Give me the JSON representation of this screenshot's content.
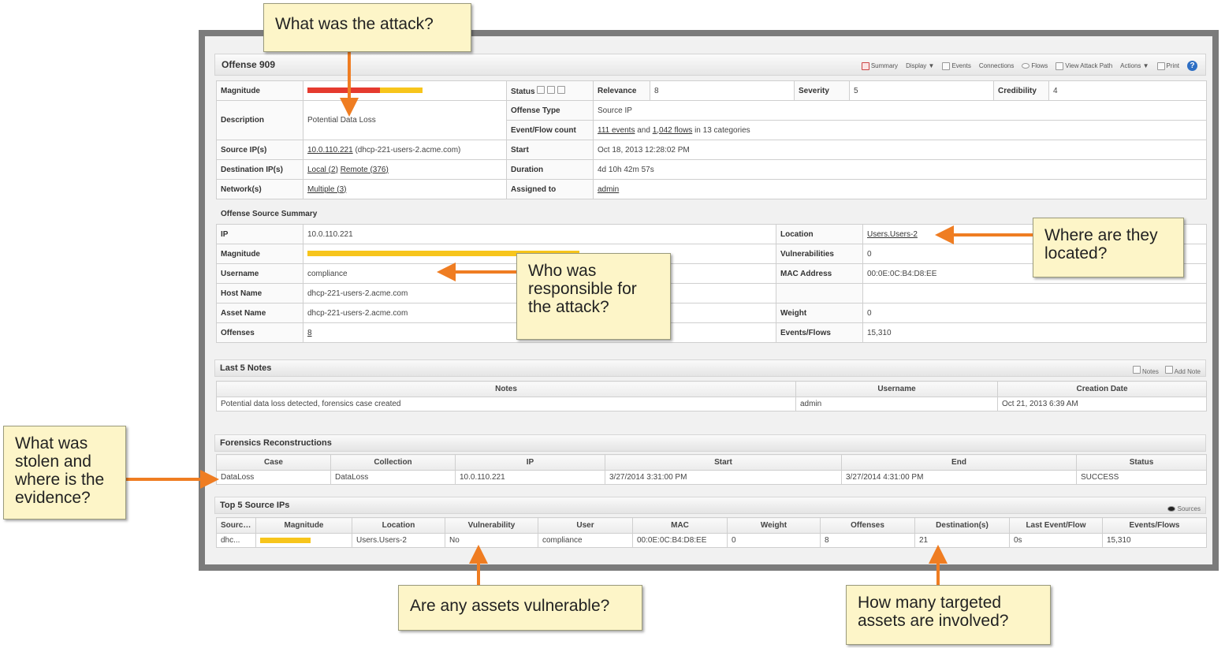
{
  "offense": {
    "title": "Offense 909",
    "toolbar": [
      "Summary",
      "Display ▼",
      "Events",
      "Connections",
      "Flows",
      "View Attack Path",
      "Actions ▼",
      "Print"
    ],
    "help": "?"
  },
  "main": {
    "magnitude_label": "Magnitude",
    "status_label": "Status",
    "relevance_label": "Relevance",
    "relevance": "8",
    "severity_label": "Severity",
    "severity": "5",
    "credibility_label": "Credibility",
    "credibility": "4",
    "description_label": "Description",
    "description": "Potential Data Loss",
    "offense_type_label": "Offense Type",
    "offense_type": "Source IP",
    "event_count_label": "Event/Flow count",
    "events_link": "111 events",
    "and_text": "and",
    "flows_link": "1,042 flows",
    "categories_text": "in 13 categories",
    "source_ip_label": "Source IP(s)",
    "source_ip": "10.0.110.221",
    "source_host": "(dhcp-221-users-2.acme.com)",
    "start_label": "Start",
    "start": "Oct 18, 2013 12:28:02 PM",
    "dest_ip_label": "Destination IP(s)",
    "dest_local": "Local (2)",
    "dest_remote": "Remote (376)",
    "duration_label": "Duration",
    "duration": "4d 10h 42m 57s",
    "networks_label": "Network(s)",
    "networks": "Multiple (3)",
    "assigned_label": "Assigned to",
    "assigned": "admin",
    "magnitude_fraction_red": 0.63,
    "magnitude_fraction_yellow": 0.37
  },
  "source_summary": {
    "title": "Offense Source Summary",
    "ip_label": "IP",
    "ip": "10.0.110.221",
    "location_label": "Location",
    "location": "Users.Users-2",
    "magnitude_label": "Magnitude",
    "vulnerabilities_label": "Vulnerabilities",
    "vulnerabilities": "0",
    "username_label": "Username",
    "username": "compliance",
    "mac_label": "MAC Address",
    "mac": "00:0E:0C:B4:D8:EE",
    "hostname_label": "Host Name",
    "hostname": "dhcp-221-users-2.acme.com",
    "assetname_label": "Asset Name",
    "assetname": "dhcp-221-users-2.acme.com",
    "weight_label": "Weight",
    "weight": "0",
    "offenses_label": "Offenses",
    "offenses": "8",
    "eventsflows_label": "Events/Flows",
    "eventsflows": "15,310"
  },
  "notes": {
    "title": "Last 5 Notes",
    "tools": [
      "Notes",
      "Add Note"
    ],
    "headers": [
      "Notes",
      "Username",
      "Creation Date"
    ],
    "rows": [
      [
        "Potential data loss detected, forensics case created",
        "admin",
        "Oct 21, 2013 6:39 AM"
      ]
    ]
  },
  "forensics": {
    "title": "Forensics Reconstructions",
    "headers": [
      "Case",
      "Collection",
      "IP",
      "Start",
      "End",
      "Status"
    ],
    "rows": [
      [
        "DataLoss",
        "DataLoss",
        "10.0.110.221",
        "3/27/2014 3:31:00 PM",
        "3/27/2014 4:31:00 PM",
        "SUCCESS"
      ]
    ]
  },
  "top_sources": {
    "title": "Top 5 Source IPs",
    "tools": [
      "Sources"
    ],
    "headers": [
      "Source IP",
      "Magnitude",
      "Location",
      "Vulnerability",
      "User",
      "MAC",
      "Weight",
      "Offenses",
      "Destination(s)",
      "Last Event/Flow",
      "Events/Flows"
    ],
    "row": {
      "source": "dhc...",
      "location": "Users.Users-2",
      "vulnerability": "No",
      "user": "compliance",
      "mac": "00:0E:0C:B4:D8:EE",
      "weight": "0",
      "offenses": "8",
      "destinations": "21",
      "last": "0s",
      "events": "15,310"
    }
  },
  "callouts": {
    "attack": "What was the attack?",
    "location": "Where are they located?",
    "responsible": "Who was responsible for the attack?",
    "stolen": "What was stolen and where is the evidence?",
    "vulnerable": "Are any assets vulnerable?",
    "targeted": "How many targeted assets are involved?"
  },
  "colors": {
    "magnitude_red": "#e53a2f",
    "magnitude_yellow": "#f7c51c",
    "callout_bg": "#fdf5c8",
    "arrow": "#ef7d22"
  }
}
